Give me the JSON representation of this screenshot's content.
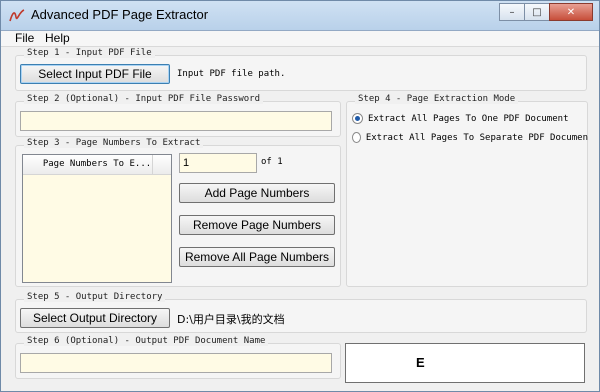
{
  "window": {
    "title": "Advanced PDF Page Extractor",
    "icon": "pdf-app-icon",
    "controls": {
      "minimize": "–",
      "maximize": "□",
      "close": "✕"
    }
  },
  "menu": {
    "items": [
      "File",
      "Help"
    ]
  },
  "step1": {
    "legend": "Step 1 - Input PDF File",
    "button_label": "Select Input PDF File",
    "path_label": "Input PDF file path."
  },
  "step2": {
    "legend": "Step 2 (Optional) - Input PDF File Password",
    "password_value": ""
  },
  "step3": {
    "legend": "Step 3 - Page Numbers To Extract",
    "list_header": "Page Numbers To E...",
    "page_input_value": "1",
    "of_label": "of 1",
    "add_button_label": "Add Page Numbers",
    "remove_button_label": "Remove Page Numbers",
    "remove_all_button_label": "Remove All Page Numbers"
  },
  "step4": {
    "legend": "Step 4 - Page Extraction Mode",
    "option1_label": "Extract All Pages To One PDF Document",
    "option2_label": "Extract All Pages To Separate PDF Documen",
    "selected_option": 1
  },
  "step5": {
    "legend": "Step 5 - Output Directory",
    "button_label": "Select Output Directory",
    "path_label": "D:\\用户目录\\我的文档"
  },
  "step6": {
    "legend": "Step 6 (Optional) - Output PDF Document Name",
    "name_value": ""
  },
  "execute": {
    "label": "E"
  },
  "colors": {
    "field_background": "#fffbe5",
    "titlebar": "#c4d8ee",
    "close_button": "#c74e3a"
  }
}
